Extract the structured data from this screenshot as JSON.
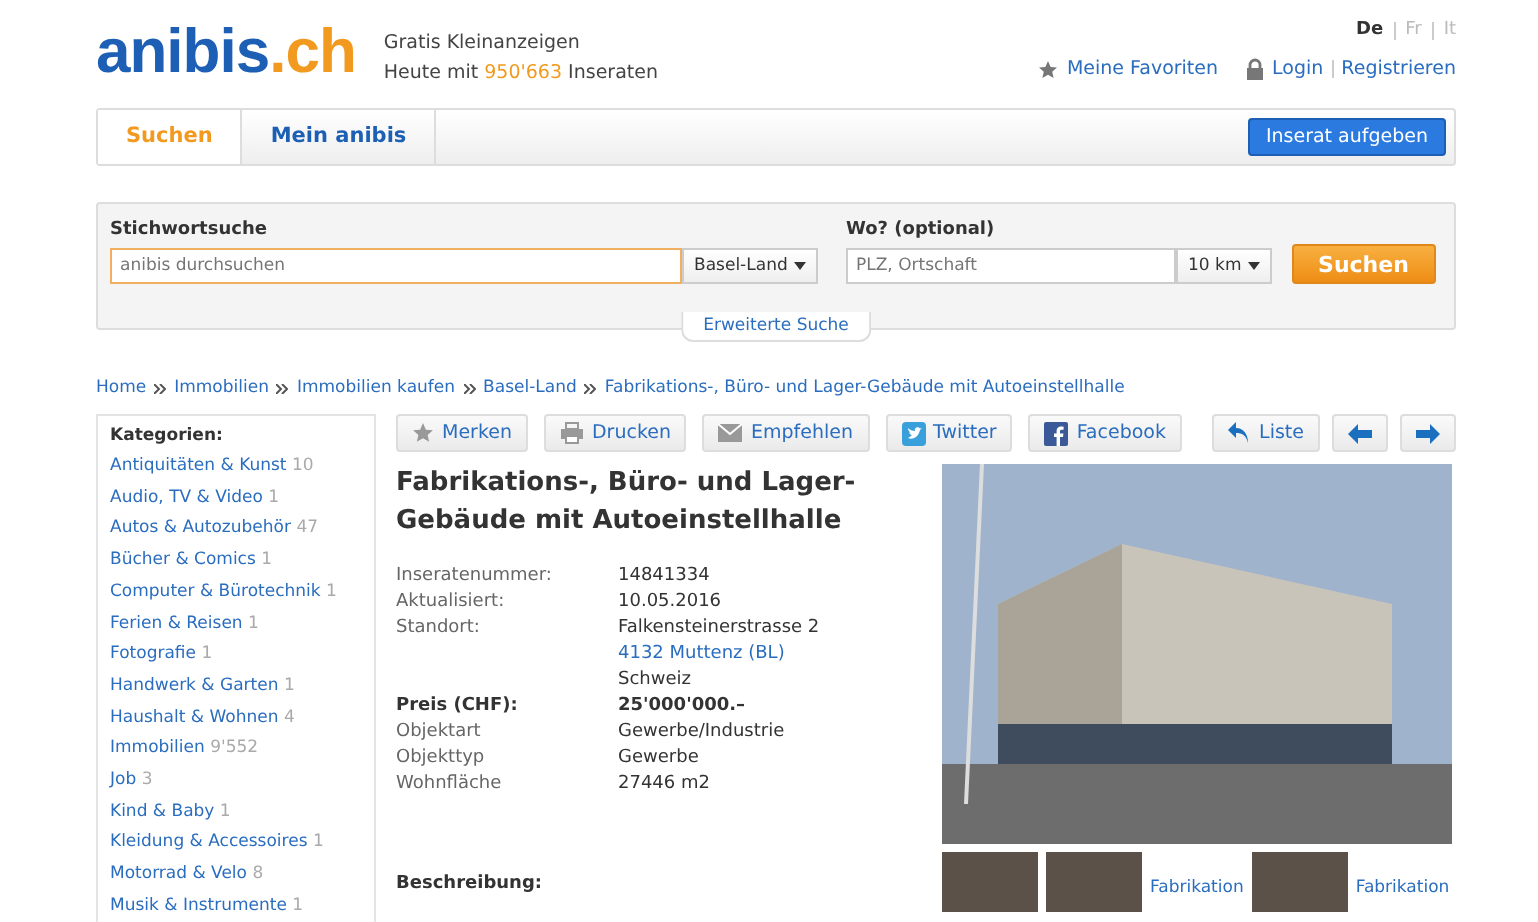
{
  "header": {
    "logo_main": "anibis",
    "logo_tld": ".ch",
    "tagline": "Gratis Kleinanzeigen",
    "count_prefix": "Heute mit",
    "count": "950'663",
    "count_suffix": "Inseraten",
    "languages": [
      {
        "label": "De",
        "selected": true
      },
      {
        "label": "Fr",
        "selected": false
      },
      {
        "label": "It",
        "selected": false
      }
    ],
    "favorites": "Meine Favoriten",
    "login": "Login",
    "register": "Registrieren"
  },
  "tabs": [
    {
      "label": "Suchen",
      "selected": true
    },
    {
      "label": "Mein anibis",
      "selected": false
    }
  ],
  "post_button": "Inserat aufgeben",
  "search": {
    "keyword_label": "Stichwortsuche",
    "keyword_placeholder": "anibis durchsuchen",
    "region": "Basel-Land",
    "where_label": "Wo? (optional)",
    "where_placeholder": "PLZ, Ortschaft",
    "radius": "10 km",
    "submit": "Suchen",
    "advanced": "Erweiterte Suche"
  },
  "breadcrumb": [
    "Home",
    "Immobilien",
    "Immobilien kaufen",
    "Basel-Land",
    "Fabrikations-, Büro- und Lager-Gebäude mit Autoeinstellhalle"
  ],
  "sidebar": {
    "title": "Kategorien:",
    "items": [
      {
        "label": "Antiquitäten & Kunst",
        "count": "10"
      },
      {
        "label": "Audio, TV & Video",
        "count": "1"
      },
      {
        "label": "Autos & Autozubehör",
        "count": "47"
      },
      {
        "label": "Bücher & Comics",
        "count": "1"
      },
      {
        "label": "Computer & Bürotechnik",
        "count": "1"
      },
      {
        "label": "Ferien & Reisen",
        "count": "1"
      },
      {
        "label": "Fotografie",
        "count": "1"
      },
      {
        "label": "Handwerk & Garten",
        "count": "1"
      },
      {
        "label": "Haushalt & Wohnen",
        "count": "4"
      },
      {
        "label": "Immobilien",
        "count": "9'552"
      },
      {
        "label": "Job",
        "count": "3"
      },
      {
        "label": "Kind & Baby",
        "count": "1"
      },
      {
        "label": "Kleidung & Accessoires",
        "count": "1"
      },
      {
        "label": "Motorrad & Velo",
        "count": "8"
      },
      {
        "label": "Musik & Instrumente",
        "count": "1"
      }
    ]
  },
  "toolbar": [
    {
      "kind": "star",
      "label": "Merken"
    },
    {
      "kind": "print",
      "label": "Drucken"
    },
    {
      "kind": "mail",
      "label": "Empfehlen"
    },
    {
      "kind": "twitter",
      "label": "Twitter"
    },
    {
      "kind": "facebook",
      "label": "Facebook"
    }
  ],
  "nav": [
    {
      "kind": "back",
      "label": "Liste"
    },
    {
      "kind": "prev"
    },
    {
      "kind": "next"
    }
  ],
  "listing": {
    "title": "Fabrikations-, Büro- und Lager-Gebäude mit Autoeinstellhalle",
    "details": [
      {
        "label": "Inseratenummer:",
        "values": [
          {
            "text": "14841334",
            "kind": "plain"
          }
        ]
      },
      {
        "label": "Aktualisiert:",
        "values": [
          {
            "text": "10.05.2016",
            "kind": "plain"
          }
        ]
      },
      {
        "label": "Standort:",
        "values": [
          {
            "text": "Falkensteinerstrasse 2",
            "kind": "plain"
          },
          {
            "text": "4132 Muttenz (BL)",
            "kind": "link"
          },
          {
            "text": "Schweiz",
            "kind": "plain"
          }
        ]
      },
      {
        "label": "Preis (CHF):",
        "values": [
          {
            "text": "25'000'000.–",
            "kind": "price"
          }
        ]
      },
      {
        "label": "Objektart",
        "values": [
          {
            "text": "Gewerbe/Industrie",
            "kind": "plain"
          }
        ]
      },
      {
        "label": "Objekttyp",
        "values": [
          {
            "text": "Gewerbe",
            "kind": "plain"
          }
        ]
      },
      {
        "label": "Wohnfläche",
        "values": [
          {
            "text": "27446 m2",
            "kind": "plain"
          }
        ]
      }
    ],
    "description_label": "Beschreibung:"
  },
  "gallery": [
    {
      "kind": "photo"
    },
    {
      "kind": "photo"
    },
    {
      "kind": "link",
      "text": "Fabrikation"
    },
    {
      "kind": "photo"
    },
    {
      "kind": "link",
      "text": "Fabrikation"
    }
  ]
}
